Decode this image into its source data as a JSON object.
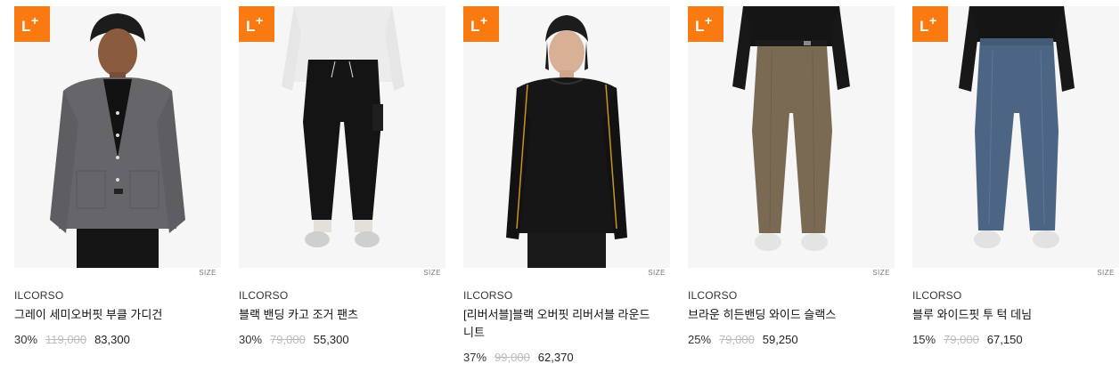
{
  "products": [
    {
      "badge": "L+",
      "size_label": "SIZE",
      "brand": "ILCORSO",
      "name": "그레이 세미오버핏 부클 가디건",
      "discount": "30%",
      "original_price": "119,000",
      "price": "83,300"
    },
    {
      "badge": "L+",
      "size_label": "SIZE",
      "brand": "ILCORSO",
      "name": "블랙 밴딩 카고 조거 팬츠",
      "discount": "30%",
      "original_price": "79,000",
      "price": "55,300"
    },
    {
      "badge": "L+",
      "size_label": "SIZE",
      "brand": "ILCORSO",
      "name": "[리버서블]블랙 오버핏 리버서블 라운드 니트",
      "discount": "37%",
      "original_price": "99,000",
      "price": "62,370"
    },
    {
      "badge": "L+",
      "size_label": "SIZE",
      "brand": "ILCORSO",
      "name": "브라운 히든밴딩 와이드 슬랙스",
      "discount": "25%",
      "original_price": "79,000",
      "price": "59,250"
    },
    {
      "badge": "L+",
      "size_label": "SIZE",
      "brand": "ILCORSO",
      "name": "블루 와이드핏 투 턱 데님",
      "discount": "15%",
      "original_price": "79,000",
      "price": "67,150"
    }
  ],
  "colors": {
    "badge": "#f97a10"
  }
}
